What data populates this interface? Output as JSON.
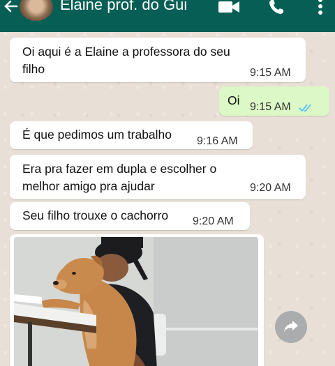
{
  "header": {
    "contact_name": "Elaine prof. do Gui",
    "bg_color": "#075e54",
    "icons": [
      "back-arrow-icon",
      "video-call-icon",
      "phone-call-icon",
      "more-options-icon"
    ]
  },
  "messages": [
    {
      "direction": "in",
      "text": "Oi aqui é a Elaine a professora do seu filho",
      "time": "9:15 AM"
    },
    {
      "direction": "out",
      "text": "Oi",
      "time": "9:15 AM",
      "status": "read",
      "status_icon": "double-check-icon"
    },
    {
      "direction": "in",
      "text": "É que pedimos um trabalho",
      "time": "9:16 AM"
    },
    {
      "direction": "in",
      "text": "Era pra fazer em dupla e escolher o melhor amigo pra ajudar",
      "time": "9:20 AM"
    },
    {
      "direction": "in",
      "text": "Seu filho trouxe o cachorro",
      "time": "9:20 AM"
    },
    {
      "direction": "in",
      "type": "image",
      "image": "dog-with-boy-photo"
    }
  ],
  "colors": {
    "incoming_bubble": "#ffffff",
    "outgoing_bubble": "#dcf8c6",
    "read_ticks": "#4fc3f7"
  }
}
